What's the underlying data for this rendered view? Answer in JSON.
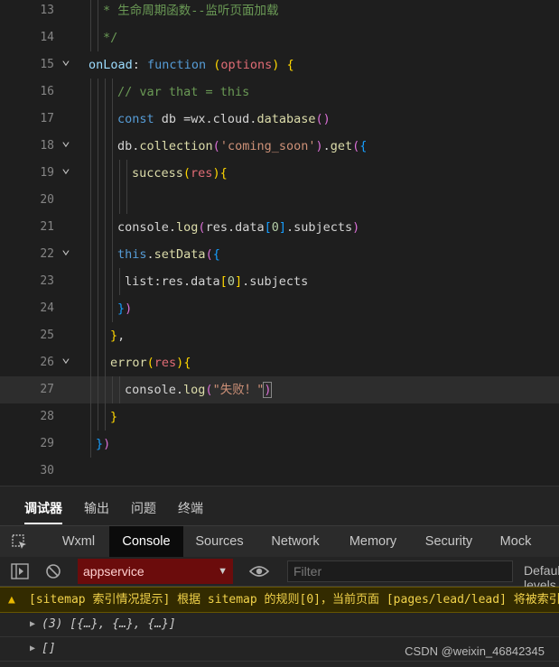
{
  "editor": {
    "lines": [
      {
        "num": "13",
        "fold": false,
        "indent": 1,
        "tokens": [
          [
            "t-comment",
            "* 生命周期函数--监听页面加载"
          ]
        ]
      },
      {
        "num": "14",
        "fold": false,
        "indent": 1,
        "tokens": [
          [
            "t-comment",
            "*/"
          ]
        ]
      },
      {
        "num": "15",
        "fold": true,
        "indent": 0,
        "tokens": [
          [
            "t-key",
            "onLoad"
          ],
          [
            "t-plain",
            ": "
          ],
          [
            "t-kw",
            "function"
          ],
          [
            "t-plain",
            " "
          ],
          [
            "t-br1",
            "("
          ],
          [
            "t-param",
            "options"
          ],
          [
            "t-br1",
            ")"
          ],
          [
            "t-plain",
            " "
          ],
          [
            "t-br1",
            "{"
          ]
        ]
      },
      {
        "num": "16",
        "fold": false,
        "indent": 2,
        "tokens": [
          [
            "t-comment",
            "// var that = this"
          ]
        ]
      },
      {
        "num": "17",
        "fold": false,
        "indent": 2,
        "tokens": [
          [
            "t-kw",
            "const"
          ],
          [
            "t-plain",
            " db =wx.cloud."
          ],
          [
            "t-fn",
            "database"
          ],
          [
            "t-br2",
            "()"
          ]
        ]
      },
      {
        "num": "18",
        "fold": true,
        "indent": 2,
        "tokens": [
          [
            "t-plain",
            "db."
          ],
          [
            "t-fn",
            "collection"
          ],
          [
            "t-br2",
            "("
          ],
          [
            "t-str",
            "'coming_soon'"
          ],
          [
            "t-br2",
            ")"
          ],
          [
            "t-plain",
            "."
          ],
          [
            "t-fn",
            "get"
          ],
          [
            "t-br2",
            "("
          ],
          [
            "t-br3",
            "{"
          ]
        ]
      },
      {
        "num": "19",
        "fold": true,
        "indent": 3,
        "tokens": [
          [
            "t-fn",
            "success"
          ],
          [
            "t-br1",
            "("
          ],
          [
            "t-param",
            "res"
          ],
          [
            "t-br1",
            ")"
          ],
          [
            "t-br1",
            "{"
          ]
        ]
      },
      {
        "num": "20",
        "fold": false,
        "indent": 3,
        "tokens": []
      },
      {
        "num": "21",
        "fold": false,
        "indent": 2,
        "tokens": [
          [
            "t-plain",
            "console."
          ],
          [
            "t-fn",
            "log"
          ],
          [
            "t-br2",
            "("
          ],
          [
            "t-plain",
            "res.data"
          ],
          [
            "t-br3",
            "["
          ],
          [
            "t-num",
            "0"
          ],
          [
            "t-br3",
            "]"
          ],
          [
            "t-plain",
            ".subjects"
          ],
          [
            "t-br2",
            ")"
          ]
        ]
      },
      {
        "num": "22",
        "fold": true,
        "indent": 2,
        "tokens": [
          [
            "t-kw",
            "this"
          ],
          [
            "t-plain",
            "."
          ],
          [
            "t-fn",
            "setData"
          ],
          [
            "t-br2",
            "("
          ],
          [
            "t-br3",
            "{"
          ]
        ]
      },
      {
        "num": "23",
        "fold": false,
        "indent": 2.5,
        "tokens": [
          [
            "t-plain",
            "list:res.data"
          ],
          [
            "t-br1",
            "["
          ],
          [
            "t-num",
            "0"
          ],
          [
            "t-br1",
            "]"
          ],
          [
            "t-plain",
            ".subjects"
          ]
        ]
      },
      {
        "num": "24",
        "fold": false,
        "indent": 2,
        "tokens": [
          [
            "t-br3",
            "}"
          ],
          [
            "t-br2",
            ")"
          ]
        ]
      },
      {
        "num": "25",
        "fold": false,
        "indent": 1.5,
        "tokens": [
          [
            "t-br1",
            "}"
          ],
          [
            "t-plain",
            ","
          ]
        ]
      },
      {
        "num": "26",
        "fold": true,
        "indent": 1.5,
        "tokens": [
          [
            "t-fn",
            "error"
          ],
          [
            "t-br1",
            "("
          ],
          [
            "t-param",
            "res"
          ],
          [
            "t-br1",
            ")"
          ],
          [
            "t-br1",
            "{"
          ]
        ]
      },
      {
        "num": "27",
        "fold": false,
        "indent": 2.5,
        "current": true,
        "tokens": [
          [
            "t-plain",
            "console."
          ],
          [
            "t-fn",
            "log"
          ],
          [
            "t-br2",
            "("
          ],
          [
            "t-str",
            "\"失败！\""
          ],
          [
            "t-br2",
            ")"
          ]
        ]
      },
      {
        "num": "28",
        "fold": false,
        "indent": 1.5,
        "tokens": [
          [
            "t-br1",
            "}"
          ]
        ]
      },
      {
        "num": "29",
        "fold": false,
        "indent": 0.5,
        "tokens": [
          [
            "t-br3",
            "}"
          ],
          [
            "t-br2",
            ")"
          ]
        ]
      },
      {
        "num": "30",
        "fold": false,
        "indent": 0,
        "tokens": []
      }
    ]
  },
  "devtools": {
    "panel_tabs": [
      "调试器",
      "输出",
      "问题",
      "终端"
    ],
    "active_panel": "调试器",
    "tool_tabs": [
      "Wxml",
      "Console",
      "Sources",
      "Network",
      "Memory",
      "Security",
      "Mock"
    ],
    "active_tool": "Console",
    "context_select": "appservice",
    "filter_placeholder": "Filter",
    "levels_label": "Default levels",
    "messages": {
      "warning": "[sitemap 索引情况提示] 根据 sitemap 的规则[0]，当前页面 [pages/lead/lead] 将被索引",
      "log1": "(3) [{…}, {…}, {…}]",
      "log2": "[]"
    },
    "colors": {
      "warning_bg": "#332b00",
      "context_bg": "#6b0c0c",
      "active_tab_bg": "#0b0b0b"
    }
  },
  "watermark": "CSDN @weixin_46842345"
}
